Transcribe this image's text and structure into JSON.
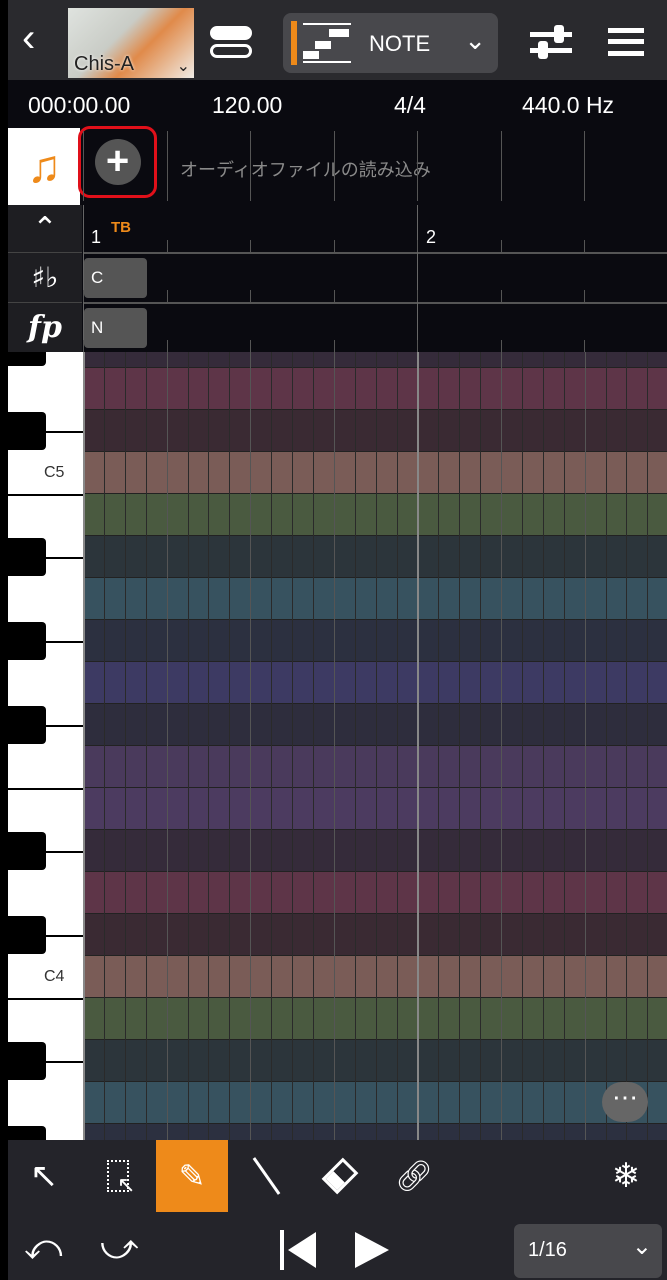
{
  "header": {
    "singer": "Chis-A",
    "mode": "NOTE"
  },
  "info": {
    "time": "000:00.00",
    "tempo": "120.00",
    "beat": "4/4",
    "pitch": "440.0 Hz"
  },
  "audio": {
    "label": "オーディオファイルの読み込み"
  },
  "ruler": {
    "bar1": "1",
    "tb": "TB",
    "bar2": "2"
  },
  "tracks": {
    "key": "C",
    "dynamics": "N"
  },
  "piano": {
    "c5": "C5",
    "c4": "C4"
  },
  "bottom": {
    "quantize": "1/16"
  },
  "colors": {
    "accent": "#ee8a1a",
    "highlight": "#e0101a"
  }
}
